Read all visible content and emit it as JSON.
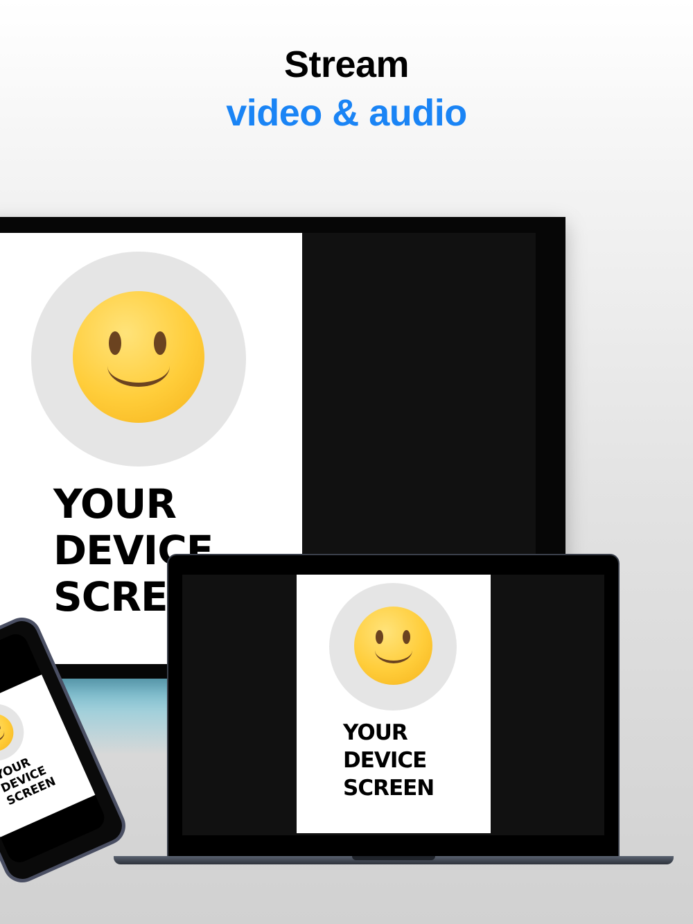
{
  "headline": {
    "line1": "Stream",
    "line2": "video & audio"
  },
  "mirror": {
    "line1": "YOUR",
    "line2": "DEVICE",
    "line3": "SCREEN",
    "tv_line3_visible": "SCRE"
  },
  "colors": {
    "accent": "#1a84f5",
    "bezel": "#060606",
    "screen_dark": "#111111"
  },
  "icons": [
    "smiling-face-emoji",
    "device-tv",
    "device-laptop",
    "device-phone"
  ]
}
